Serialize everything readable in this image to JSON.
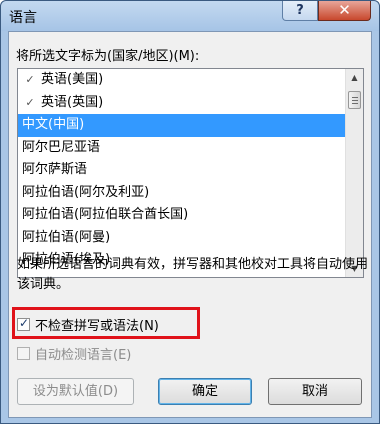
{
  "window": {
    "title": "语言",
    "help_label": "?",
    "close_label": "✕"
  },
  "language_list": {
    "label": "将所选文字标为(国家/地区)(M):",
    "items": [
      {
        "label": "英语(美国)",
        "icon": "spell-check-icon",
        "selected": false
      },
      {
        "label": "英语(英国)",
        "icon": "spell-check-icon",
        "selected": false
      },
      {
        "label": "中文(中国)",
        "icon": null,
        "selected": true
      },
      {
        "label": "阿尔巴尼亚语",
        "icon": null,
        "selected": false
      },
      {
        "label": "阿尔萨斯语",
        "icon": null,
        "selected": false
      },
      {
        "label": "阿拉伯语(阿尔及利亚)",
        "icon": null,
        "selected": false
      },
      {
        "label": "阿拉伯语(阿拉伯联合酋长国)",
        "icon": null,
        "selected": false
      },
      {
        "label": "阿拉伯语(阿曼)",
        "icon": null,
        "selected": false
      },
      {
        "label": "阿拉伯语(埃及)",
        "icon": null,
        "selected": false
      }
    ],
    "spell_icon_glyph": "ᵃᵇᶜ"
  },
  "info": {
    "text": "如果所选语言的词典有效，拼写器和其他校对工具将自动使用该词典。"
  },
  "options": {
    "no_proofing": {
      "label": "不检查拼写或语法(N)",
      "checked": true,
      "enabled": true
    },
    "detect_language": {
      "label": "自动检测语言(E)",
      "checked": false,
      "enabled": false
    }
  },
  "buttons": {
    "set_default": "设为默认值(D)",
    "ok": "确定",
    "cancel": "取消"
  },
  "colors": {
    "selection": "#3399ff",
    "highlight_box": "#e0121a",
    "close_button": "#c8482d"
  }
}
